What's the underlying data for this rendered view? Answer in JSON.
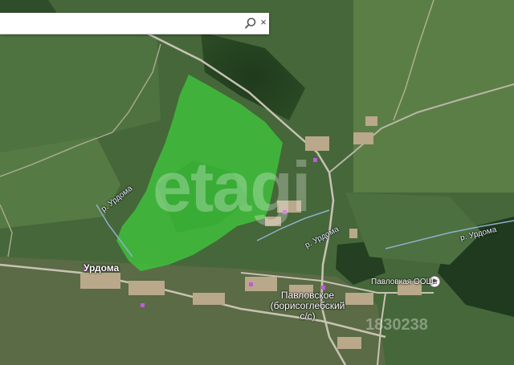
{
  "search": {
    "value": "",
    "placeholder": ""
  },
  "icons": {
    "search": "search-icon",
    "close": "close-icon",
    "school": "school-icon"
  },
  "colors": {
    "field_highlight": "#3fbf3c",
    "road": "#c8c2b4",
    "river": "#8fb0c8"
  },
  "labels": {
    "urdoma": "Урдома",
    "pavlovskoe_line1": "Павловское",
    "pavlovskoe_line2": "(борисоглебский",
    "pavlovskoe_line3": "с/с)",
    "river_urdoma_1": "р. Урдома",
    "river_urdoma_2": "р. Урдома",
    "river_urdoma_3": "р. Урдома",
    "school": "Павловкая ООШ"
  },
  "watermark": {
    "brand": "etagi",
    "id": "1830238"
  }
}
